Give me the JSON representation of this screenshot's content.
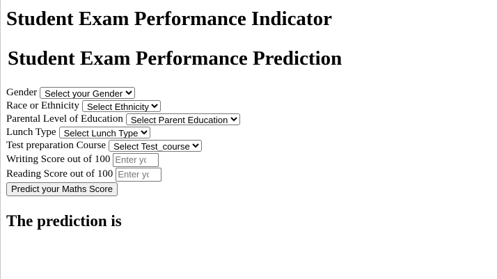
{
  "page": {
    "title": "Student Exam Performance Indicator",
    "subtitle": "Student Exam Performance Prediction",
    "result_text": "The prediction is"
  },
  "form": {
    "gender": {
      "label": "Gender",
      "selected": "Select your Gender"
    },
    "ethnicity": {
      "label": "Race or Ethnicity",
      "selected": "Select Ethnicity"
    },
    "parent_education": {
      "label": "Parental Level of Education",
      "selected": "Select Parent Education"
    },
    "lunch": {
      "label": "Lunch Type",
      "selected": "Select Lunch Type"
    },
    "test_course": {
      "label": "Test preparation Course",
      "selected": "Select Test_course"
    },
    "writing_score": {
      "label": "Writing Score out of 100",
      "placeholder": "Enter yo"
    },
    "reading_score": {
      "label": "Reading Score out of 100",
      "placeholder": "Enter yo"
    },
    "submit_label": "Predict your Maths Score"
  }
}
